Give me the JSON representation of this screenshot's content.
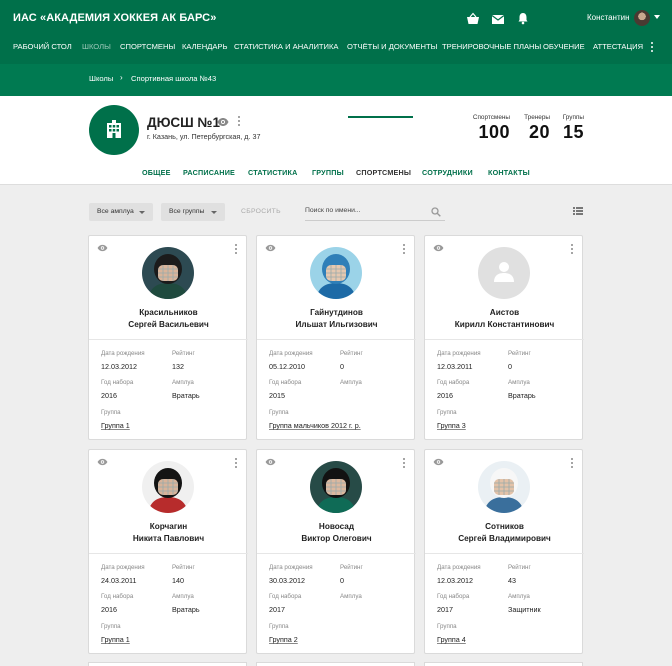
{
  "app": {
    "title": "ИАС «АКАДЕМИЯ ХОККЕЯ АК БАРС»",
    "user_name": "Константин"
  },
  "top_icons": [
    "basket-icon",
    "mail-icon",
    "bell-icon"
  ],
  "nav": {
    "items": [
      {
        "label": "РАБОЧИЙ СТОЛ",
        "state": "normal"
      },
      {
        "label": "ШКОЛЫ",
        "state": "active"
      },
      {
        "label": "СПОРТСМЕНЫ",
        "state": "normal"
      },
      {
        "label": "КАЛЕНДАРЬ",
        "state": "normal"
      },
      {
        "label": "СТАТИСТИКА И АНАЛИТИКА",
        "state": "normal"
      },
      {
        "label": "ОТЧЁТЫ И ДОКУМЕНТЫ",
        "state": "normal"
      },
      {
        "label": "ТРЕНИРОВОЧНЫЕ ПЛАНЫ",
        "state": "normal"
      },
      {
        "label": "ОБУЧЕНИЕ",
        "state": "normal"
      },
      {
        "label": "АТТЕСТАЦИЯ",
        "state": "normal"
      }
    ]
  },
  "breadcrumb": {
    "root": "Школы",
    "separator": "›",
    "current": "Спортивная школа №43"
  },
  "school": {
    "name": "ДЮСШ №1",
    "address": "г. Казань, ул. Петербургская, д. 37",
    "stats": [
      {
        "label": "Спортсмены",
        "value": "100"
      },
      {
        "label": "Тренеры",
        "value": "20"
      },
      {
        "label": "Группы",
        "value": "15"
      }
    ]
  },
  "tabs": [
    {
      "label": "ОБЩЕЕ",
      "active": false
    },
    {
      "label": "РАСПИСАНИЕ",
      "active": false
    },
    {
      "label": "СТАТИСТИКА",
      "active": false
    },
    {
      "label": "ГРУППЫ",
      "active": false
    },
    {
      "label": "СПОРТСМЕНЫ",
      "active": true
    },
    {
      "label": "СОТРУДНИКИ",
      "active": false
    },
    {
      "label": "КОНТАКТЫ",
      "active": false
    }
  ],
  "filters": {
    "role": "Все амплуа",
    "group": "Все группы",
    "reset": "СБРОСИТЬ",
    "search_placeholder": "Поиск по имени..."
  },
  "field_labels": {
    "birth": "Дата рождения",
    "rating": "Рейтинг",
    "year": "Год набора",
    "role": "Амплуа",
    "group": "Группа"
  },
  "athletes": [
    {
      "last": "Красильников",
      "first": "Сергей Васильевич",
      "birth": "12.03.2012",
      "rating": "132",
      "year": "2016",
      "role": "Вратарь",
      "group": "Группа 1",
      "photo": "player-photo-dark"
    },
    {
      "last": "Гайнутдинов",
      "first": "Ильшат Ильгизович",
      "birth": "05.12.2010",
      "rating": "0",
      "year": "2015",
      "role": "",
      "group": "Группа мальчиков 2012 г. р.",
      "photo": "goalie-photo-blue"
    },
    {
      "last": "Аистов",
      "first": "Кирилл Константинович",
      "birth": "12.03.2011",
      "rating": "0",
      "year": "2016",
      "role": "Вратарь",
      "group": "Группа 3",
      "photo": "placeholder"
    },
    {
      "last": "Корчагин",
      "first": "Никита Павлович",
      "birth": "24.03.2011",
      "rating": "140",
      "year": "2016",
      "role": "Вратарь",
      "group": "Группа 1",
      "photo": "player-photo-red"
    },
    {
      "last": "Новосад",
      "first": "Виктор Олегович",
      "birth": "30.03.2012",
      "rating": "0",
      "year": "2017",
      "role": "",
      "group": "Группа 2",
      "photo": "player-photo-green"
    },
    {
      "last": "Сотников",
      "first": "Сергей Владимирович",
      "birth": "12.03.2012",
      "rating": "43",
      "year": "2017",
      "role": "Защитник",
      "group": "Группа 4",
      "photo": "player-photo-white"
    }
  ],
  "colors": {
    "primary": "#00704a",
    "band": "#007a51",
    "background": "#eeeeee"
  }
}
